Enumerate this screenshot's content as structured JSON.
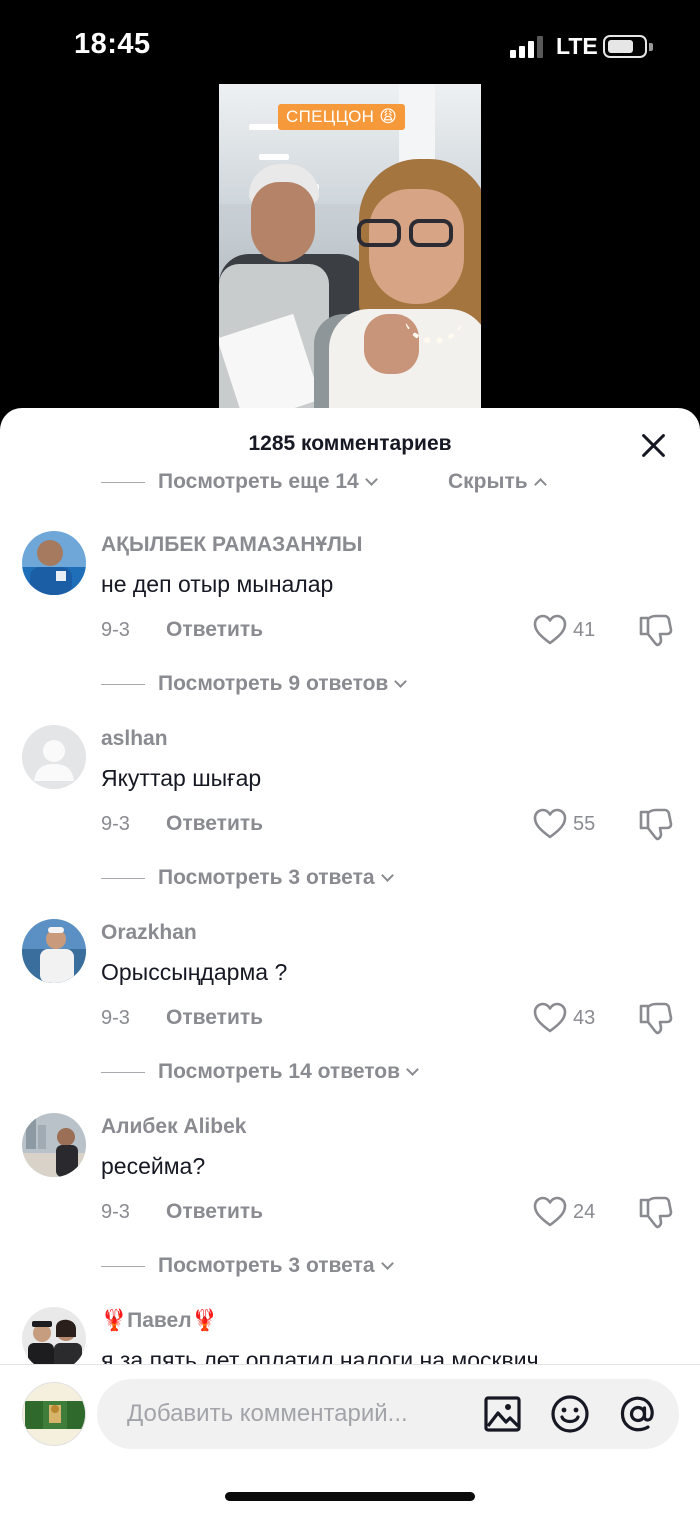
{
  "status_bar": {
    "time": "18:45",
    "network": "LTE",
    "icons": [
      "signal-icon",
      "battery-icon"
    ]
  },
  "video": {
    "tag": "СПЕЦЦОН 😩"
  },
  "sheet": {
    "title": "1285 комментариев",
    "close_icon": "close-icon",
    "prev_thread": {
      "more": "Посмотреть еще 14",
      "hide": "Скрыть"
    },
    "comments": [
      {
        "name": "АҚЫЛБЕК РАМАЗАНҰЛЫ",
        "text": "не деп отыр мыналар",
        "date": "9-3",
        "reply": "Ответить",
        "likes": "41",
        "replies_link": "Посмотреть 9 ответов"
      },
      {
        "name": "aslhan",
        "text": "Якуттар шығар",
        "date": "9-3",
        "reply": "Ответить",
        "likes": "55",
        "replies_link": "Посмотреть 3 ответа"
      },
      {
        "name": "Orazkhan",
        "text": "Орыссыңдарма ?",
        "date": "9-3",
        "reply": "Ответить",
        "likes": "43",
        "replies_link": "Посмотреть 14 ответов"
      },
      {
        "name": "Алибек Alibek",
        "text": "ресейма?",
        "date": "9-3",
        "reply": "Ответить",
        "likes": "24",
        "replies_link": "Посмотреть 3 ответа"
      },
      {
        "name": "🦞Павел🦞",
        "text": "я за пять лет оплатил налоги на москвич"
      }
    ]
  },
  "input": {
    "placeholder": "Добавить комментарий...",
    "icons": [
      "image-icon",
      "emoji-icon",
      "mention-icon"
    ]
  }
}
